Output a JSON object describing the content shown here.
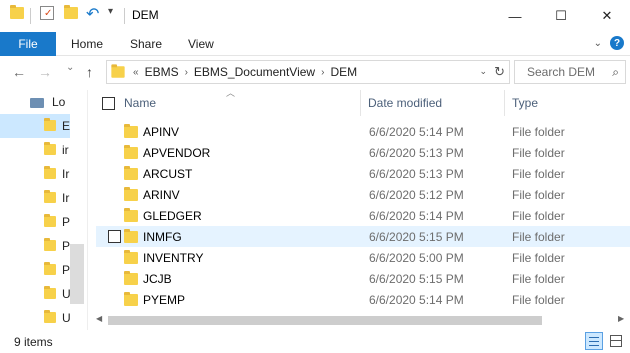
{
  "window": {
    "title": "DEM",
    "controls": {
      "minimize": "—",
      "maximize": "☐",
      "close": "✕"
    }
  },
  "ribbon": {
    "tabs": [
      {
        "label": "File",
        "active": true
      },
      {
        "label": "Home"
      },
      {
        "label": "Share"
      },
      {
        "label": "View"
      }
    ],
    "expand_icon": "chevron-down-icon",
    "help_label": "?"
  },
  "navigation": {
    "back": "←",
    "forward": "→",
    "recent": "⌄",
    "up": "↑"
  },
  "address": {
    "overflow": "«",
    "breadcrumbs": [
      "EBMS",
      "EBMS_DocumentView",
      "DEM"
    ],
    "separator": "›"
  },
  "search": {
    "placeholder": "Search DEM"
  },
  "nav_pane": {
    "items": [
      {
        "label": "Lo"
      },
      {
        "label": "E"
      },
      {
        "label": "ir"
      },
      {
        "label": "Ir"
      },
      {
        "label": "Ir"
      },
      {
        "label": "P"
      },
      {
        "label": "P"
      },
      {
        "label": "P"
      },
      {
        "label": "U"
      },
      {
        "label": "U"
      }
    ]
  },
  "columns": {
    "name": "Name",
    "date": "Date modified",
    "type": "Type"
  },
  "files": [
    {
      "name": "APINV",
      "date": "6/6/2020 5:14 PM",
      "type": "File folder"
    },
    {
      "name": "APVENDOR",
      "date": "6/6/2020 5:13 PM",
      "type": "File folder"
    },
    {
      "name": "ARCUST",
      "date": "6/6/2020 5:13 PM",
      "type": "File folder"
    },
    {
      "name": "ARINV",
      "date": "6/6/2020 5:12 PM",
      "type": "File folder"
    },
    {
      "name": "GLEDGER",
      "date": "6/6/2020 5:14 PM",
      "type": "File folder"
    },
    {
      "name": "INMFG",
      "date": "6/6/2020 5:15 PM",
      "type": "File folder"
    },
    {
      "name": "INVENTRY",
      "date": "6/6/2020 5:00 PM",
      "type": "File folder"
    },
    {
      "name": "JCJB",
      "date": "6/6/2020 5:15 PM",
      "type": "File folder"
    },
    {
      "name": "PYEMP",
      "date": "6/6/2020 5:14 PM",
      "type": "File folder"
    }
  ],
  "status": {
    "count": "9 items"
  },
  "colors": {
    "accent": "#1979ca",
    "folder": "#f7d14a",
    "hover_row": "#e5f3ff",
    "selected_nav": "#cce8ff"
  }
}
